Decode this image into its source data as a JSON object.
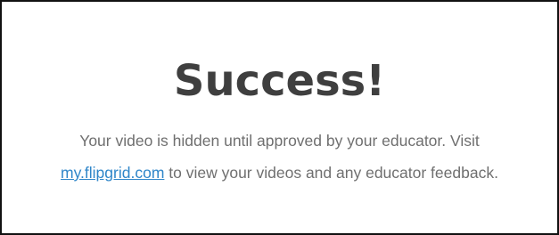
{
  "dialog": {
    "title": "Success!",
    "message_before": "Your video is hidden until approved by your educator. Visit",
    "link_text": "my.flipgrid.com",
    "message_after": " to view your videos and any educator feedback."
  },
  "colors": {
    "title": "#3f3f3f",
    "body_text": "#6f6f6f",
    "link": "#2f86c9",
    "border": "#111111",
    "background": "#ffffff"
  }
}
